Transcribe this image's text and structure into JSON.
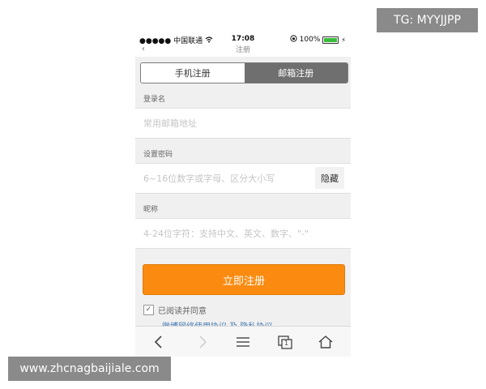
{
  "status_bar": {
    "signal": "●●●●●",
    "carrier": "中国联通",
    "wifi_icon": "wifi-icon",
    "time": "17:08",
    "lock_icon": "rotation-lock-icon",
    "battery_text": "100%",
    "battery_level": 1.0,
    "battery_color": "#3bbd3b"
  },
  "nav": {
    "page_title": "注册"
  },
  "tabs": [
    {
      "label": "手机注册",
      "active": false
    },
    {
      "label": "邮箱注册",
      "active": true
    }
  ],
  "form": {
    "login_label": "登录名",
    "login_placeholder": "常用邮箱地址",
    "password_label": "设置密码",
    "password_placeholder": "6~16位数字或字母、区分大小写",
    "hide_button": "隐藏",
    "nickname_label": "昵称",
    "nickname_placeholder": "4-24位字符：支持中文、英文、数字、\"-\""
  },
  "submit_label": "立即注册",
  "agreement": {
    "checked": true,
    "text": "已阅读并同意",
    "links": "微博网络使用协议 及 隐私协议"
  },
  "toolbar": {
    "back_icon": "back-icon",
    "forward_icon": "forward-icon",
    "menu_icon": "list-icon",
    "tabs_icon": "tabs-icon",
    "tabs_count": "1",
    "home_icon": "home-icon"
  },
  "colors": {
    "accent": "#fb8b10",
    "link": "#4a7fb5",
    "tab_inactive": "#6f6f6f"
  },
  "watermarks": {
    "tg": "TG: MYYJJPP",
    "site": "www.zhcnagbaijiale.com"
  }
}
